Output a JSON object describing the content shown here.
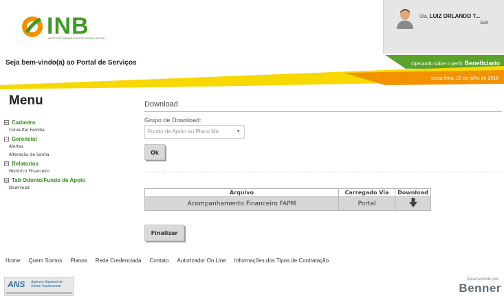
{
  "brand": {
    "name": "INB",
    "tagline": "INSTITUTO BRASILEIRO DE SAÚDE SOCIAL",
    "green": "#3f9a24",
    "orange": "#f39200"
  },
  "user": {
    "greeting": "Olá,",
    "name": "LUIZ ORLANDO T...",
    "signout": "Sair"
  },
  "header": {
    "welcome": "Seja bem-vindo(a) ao Portal de Serviços",
    "profile_prefix": "Operando sobre o perfil:",
    "profile": "Beneficiario",
    "date": "sexta-feira, 22 de julho de 2016"
  },
  "sidebar": {
    "title": "Menu",
    "items": [
      {
        "label": "Cadastro",
        "children": [
          "Consultar Família"
        ]
      },
      {
        "label": "Gerencial",
        "children": [
          "Alertas",
          "Alteração de Senha"
        ]
      },
      {
        "label": "Relatorios",
        "children": [
          "Histórico Financeiro"
        ]
      },
      {
        "label": "Tab Odonto/Fundo de Apoio",
        "children": [
          "Download"
        ]
      }
    ]
  },
  "main": {
    "title": "Download",
    "group_label": "Grupo de Download:",
    "group_value": "Fundo de Apoio ao Plano Mé",
    "ok_label": "Ok",
    "table": {
      "headers": [
        "Arquivo",
        "Carregado Via",
        "Download"
      ],
      "rows": [
        {
          "file": "Acompanhamento Financeiro FAPM",
          "via": "Portal",
          "icon": "download-arrow-icon"
        }
      ]
    },
    "finish_label": "Finalizar"
  },
  "footer": {
    "links": [
      "Home",
      "Quem Somos",
      "Planos",
      "Rede Credenciada",
      "Contato",
      "Autorizador On Line",
      "Informações dos Tipos de Contratação"
    ],
    "ans_mark": "ANS",
    "ans_line1": "Agência Nacional de",
    "ans_line2": "Saúde Suplementar",
    "dev_by": "Desenvolvido por",
    "dev_name": "Benner"
  }
}
